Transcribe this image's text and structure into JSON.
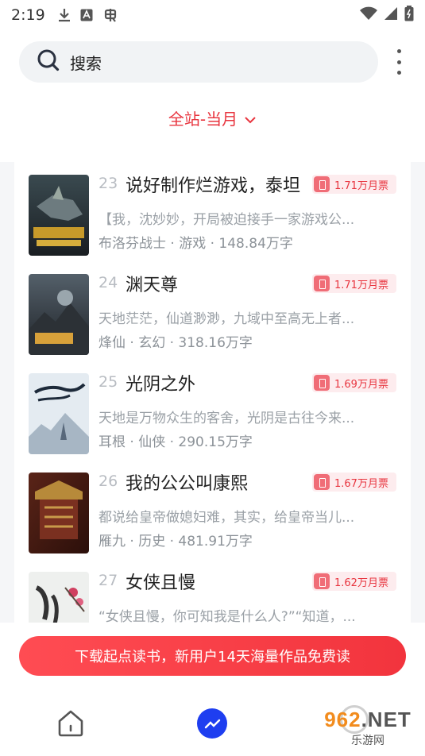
{
  "status_bar": {
    "time": "2:19"
  },
  "search": {
    "label": "搜索"
  },
  "filter": {
    "label": "全站-当月"
  },
  "books": [
    {
      "rank": "23",
      "title": "说好制作烂游戏，泰坦",
      "votes": "1.71万月票",
      "desc": "【我，沈妙妙，开局被迫接手一家游戏公...",
      "meta": "布洛芬战士 · 游戏 · 148.84万字",
      "cover": "cover-mecha"
    },
    {
      "rank": "24",
      "title": "渊天尊",
      "votes": "1.71万月票",
      "desc": "天地茫茫，仙道渺渺，九域中至高无上者...",
      "meta": "烽仙 · 玄幻 · 318.16万字",
      "cover": "cover-abyss"
    },
    {
      "rank": "25",
      "title": "光阴之外",
      "votes": "1.69万月票",
      "desc": "天地是万物众生的客舍，光阴是古往今来...",
      "meta": "耳根 · 仙侠 · 290.15万字",
      "cover": "cover-time"
    },
    {
      "rank": "26",
      "title": "我的公公叫康熙",
      "votes": "1.67万月票",
      "desc": "都说给皇帝做媳妇难，其实，给皇帝当儿...",
      "meta": "雁九 · 历史 · 481.91万字",
      "cover": "cover-palace"
    },
    {
      "rank": "27",
      "title": "女侠且慢",
      "votes": "1.62万月票",
      "desc": "“女侠且慢，你可知我是什么人?”“知道，...",
      "meta": "",
      "cover": "cover-heroine"
    }
  ],
  "promo": {
    "label": "下载起点读书，新用户14天海量作品免费读"
  },
  "watermark": {
    "main_a": "962",
    "main_b": ".NET",
    "sub": "乐游网"
  },
  "colors": {
    "accent": "#e8353f",
    "nav_active": "#1e3ef0"
  },
  "icons": [
    "download-icon",
    "a-icon",
    "bug-icon",
    "wifi-icon",
    "signal-icon",
    "battery-icon",
    "search-icon",
    "more-icon",
    "chevron-down-icon",
    "ticket-icon",
    "home-icon",
    "rank-icon"
  ]
}
